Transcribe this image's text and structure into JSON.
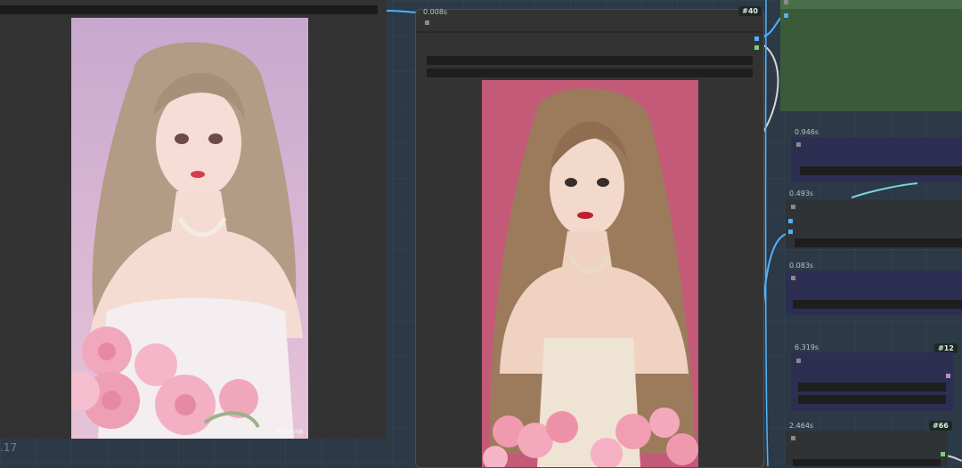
{
  "canvas": {
    "bottom_left_label": ".17"
  },
  "preview_node_left": {
    "image_desc": "illustrated-girl-with-roses",
    "watermark": "布谷鸟AI出图"
  },
  "node_40": {
    "timing": "0.008s",
    "badge": "#40",
    "image_desc": "photo-girl-with-roses"
  },
  "right_nodes": [
    {
      "timing": "0.946s",
      "badge": ""
    },
    {
      "timing": "0.493s",
      "badge": ""
    },
    {
      "timing": "0.083s",
      "badge": ""
    },
    {
      "timing": "6.319s",
      "badge": "#12"
    },
    {
      "timing": "2.464s",
      "badge": "#66"
    }
  ],
  "colors": {
    "canvas_bg": "#2b3a46",
    "node_bg": "#333333",
    "green_group": "#3a5a3a",
    "purple_node": "#2c2f52",
    "wire_blue": "#4fb3ff"
  }
}
